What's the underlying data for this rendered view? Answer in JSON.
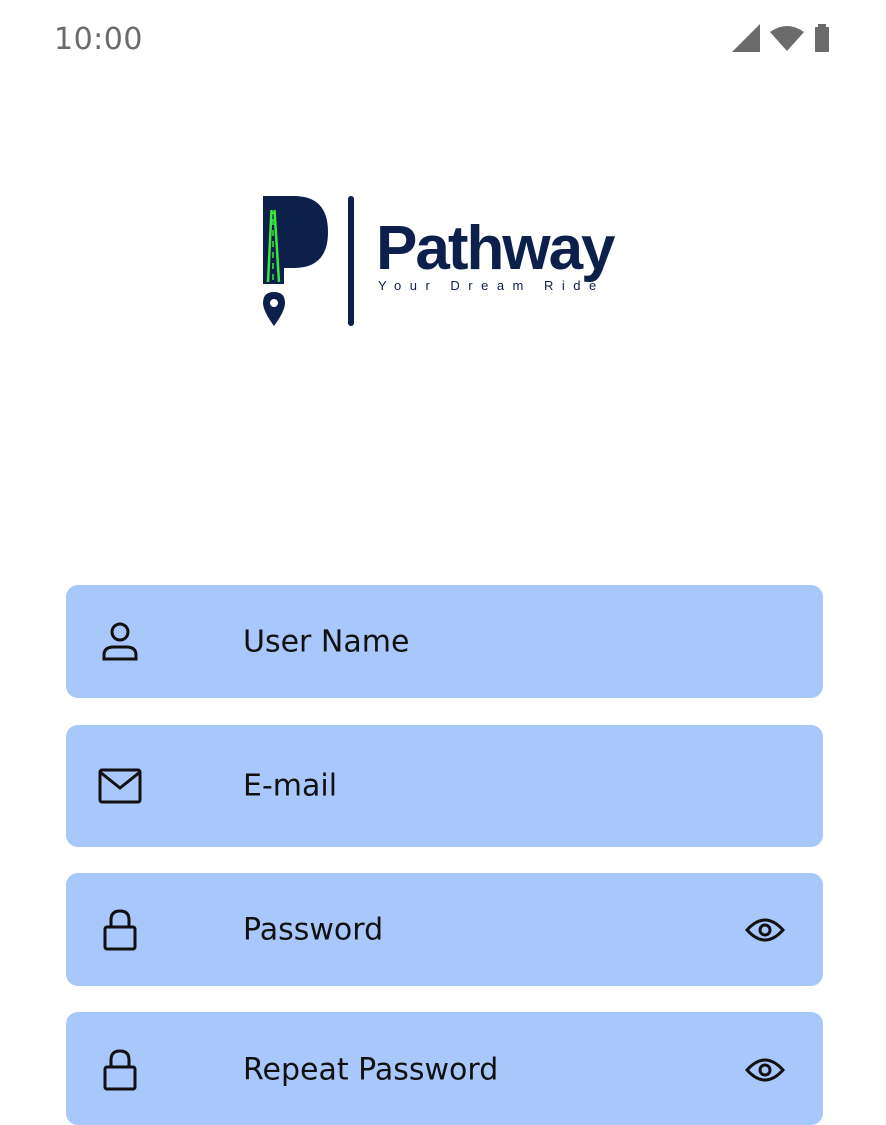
{
  "status_bar": {
    "time": "10:00",
    "icons": [
      "cellular-signal-icon",
      "wifi-icon",
      "battery-icon"
    ]
  },
  "logo": {
    "name": "Pathway",
    "tagline": "Your Dream Ride",
    "colors": {
      "navy": "#0d1f4b",
      "road_accent": "#3be83b"
    }
  },
  "form": {
    "username": {
      "placeholder": "User Name",
      "icon": "person-icon"
    },
    "email": {
      "placeholder": "E-mail",
      "icon": "mail-icon"
    },
    "password": {
      "placeholder": "Password",
      "icon": "lock-icon",
      "toggle_icon": "eye-icon"
    },
    "repeat_password": {
      "placeholder": "Repeat Password",
      "icon": "lock-icon",
      "toggle_icon": "eye-icon"
    }
  },
  "colors": {
    "field_background": "#a8c7fb",
    "status_text": "#6b6b6b"
  }
}
